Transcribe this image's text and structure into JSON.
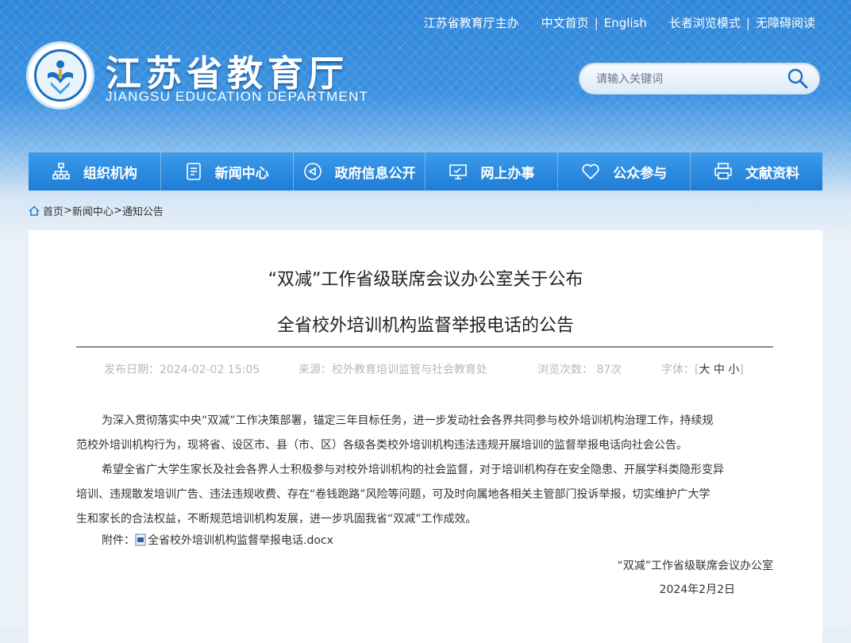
{
  "header": {
    "top_links": [
      "江苏省教育厅主办",
      "中文首页",
      "English",
      "长者浏览模式",
      "无障碍阅读"
    ],
    "site_title": "江苏省教育厅",
    "site_subtitle": "JIANGSU EDUCATION DEPARTMENT",
    "search_placeholder": "请输入关键词"
  },
  "nav": {
    "items": [
      {
        "label": "组织机构",
        "icon": "org-chart-icon"
      },
      {
        "label": "新闻中心",
        "icon": "document-icon"
      },
      {
        "label": "政府信息公开",
        "icon": "megaphone-icon"
      },
      {
        "label": "网上办事",
        "icon": "monitor-icon"
      },
      {
        "label": "公众参与",
        "icon": "heart-icon"
      },
      {
        "label": "文献资料",
        "icon": "printer-icon"
      }
    ]
  },
  "breadcrumb": {
    "items": [
      "首页",
      "新闻中心",
      "通知公告"
    ]
  },
  "article": {
    "title_line1": "“双减”工作省级联席会议办公室关于公布",
    "title_line2": "全省校外培训机构监督举报电话的公告",
    "publish_date": "发布日期：2024-02-02 15:05",
    "source": "来源：校外教育培训监管与社会教育处",
    "views": "浏览次数： 87次",
    "font_size_label": "字体：[",
    "font_size_options": [
      "大",
      "中",
      "小"
    ],
    "font_size_close": "]",
    "paragraph1_line1": "为深入贯彻落实中央“双减”工作决策部署，锚定三年目标任务，进一步发动社会各界共同参与校外培训机构治理工作，持续规",
    "paragraph1_line2": "范校外培训机构行为，现将省、设区市、县（市、区）各级各类校外培训机构违法违规开展培训的监督举报电话向社会公告。",
    "paragraph2_line1": "希望全省广大学生家长及社会各界人士积极参与对校外培训机构的社会监督，对于培训机构存在安全隐患、开展学科类隐形变异",
    "paragraph2_line2": "培训、违规散发培训广告、违法违规收费、存在“卷钱跑路”风险等问题，可及时向属地各相关主管部门投诉举报，切实维护广大学",
    "paragraph2_line3": "生和家长的合法权益，不断规范培训机构发展，进一步巩固我省“双减”工作成效。",
    "attachment_label": "附件：",
    "attachment_file": "全省校外培训机构监督举报电话.docx",
    "signature": "“双减”工作省级联席会议办公室",
    "sign_date": "2024年2月2日"
  },
  "colors": {
    "header_blue": "#2f86d9",
    "nav_blue": "#1e7cd6",
    "meta_gray": "#b8b8b8",
    "text": "#333333"
  }
}
